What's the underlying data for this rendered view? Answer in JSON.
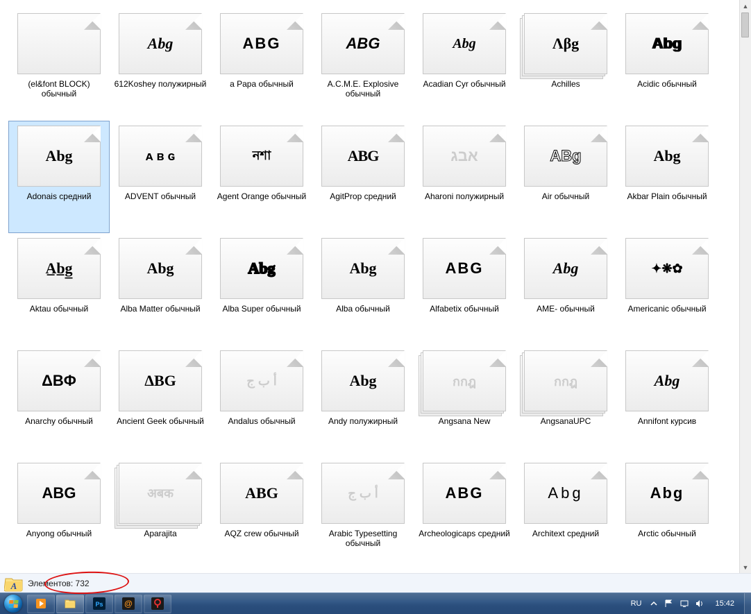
{
  "files": [
    {
      "label": "(el&font BLOCK) обычный",
      "preview": "",
      "stack": false,
      "style": "color:#000"
    },
    {
      "label": "612Koshey полужирный",
      "preview": "Abg",
      "stack": false,
      "style": "font-family:cursive;font-style:italic;font-weight:bold;"
    },
    {
      "label": "a Papa обычный",
      "preview": "ABG",
      "stack": false,
      "style": "font-family:Arial;font-weight:bold;letter-spacing:2px;"
    },
    {
      "label": "A.C.M.E. Explosive обычный",
      "preview": "ABG",
      "stack": false,
      "style": "font-family:Arial;font-weight:bold;font-style:italic;"
    },
    {
      "label": "Acadian Cyr обычный",
      "preview": "Abg",
      "stack": false,
      "style": "font-family:'Times New Roman',serif;font-style:italic;font-size:20px;"
    },
    {
      "label": "Achilles",
      "preview": "Λβg",
      "stack": true,
      "style": "font-family:serif;"
    },
    {
      "label": "Acidic обычный",
      "preview": "Abg",
      "stack": false,
      "style": "font-family:Arial;font-weight:bold;text-shadow:1px 0 #000,-1px 0 #000;"
    },
    {
      "label": "Adonais средний",
      "preview": "Abg",
      "stack": false,
      "style": "font-family:Arial Black;font-weight:900;",
      "selected": true
    },
    {
      "label": "ADVENT обычный",
      "preview": "ᴀ ʙ ɢ",
      "stack": false,
      "style": "font-family:Arial;font-size:18px;font-weight:bold;"
    },
    {
      "label": "Agent Orange обычный",
      "preview": "নশা",
      "stack": false,
      "style": "font-size:18px;"
    },
    {
      "label": "AgitProp средний",
      "preview": "ABG",
      "stack": false,
      "style": "font-family:Arial Black;font-weight:900;letter-spacing:-1px;"
    },
    {
      "label": "Aharoni полужирный",
      "preview": "אבג",
      "stack": false,
      "style": "color:#ccc;font-weight:bold;direction:rtl;"
    },
    {
      "label": "Air обычный",
      "preview": "ABg",
      "stack": false,
      "style": "font-family:Arial;font-weight:bold;-webkit-text-stroke:1px #000;color:#fff;"
    },
    {
      "label": "Akbar Plain обычный",
      "preview": "Abg",
      "stack": false,
      "style": "font-family:'Comic Sans MS',cursive;"
    },
    {
      "label": "Aktau обычный",
      "preview": "A̲b̲g̲",
      "stack": false,
      "style": "font-family:Arial Black;font-weight:900;"
    },
    {
      "label": "Alba Matter обычный",
      "preview": "Abg",
      "stack": false,
      "style": "font-family:Arial Black;font-weight:900;"
    },
    {
      "label": "Alba Super обычный",
      "preview": "Abg",
      "stack": false,
      "style": "font-family:Arial Black;font-weight:900;-webkit-text-stroke:2px #000;color:#000;"
    },
    {
      "label": "Alba обычный",
      "preview": "Abg",
      "stack": false,
      "style": "font-family:Arial Black;font-weight:900;"
    },
    {
      "label": "Alfabetix обычный",
      "preview": "ABG",
      "stack": false,
      "style": "font-family:Arial;letter-spacing:2px;"
    },
    {
      "label": "AME- обычный",
      "preview": "Abg",
      "stack": false,
      "style": "font-family:Arial Black;font-weight:900;font-style:italic;"
    },
    {
      "label": "Americanic обычный",
      "preview": "✦❋✿",
      "stack": false,
      "style": "font-size:18px;"
    },
    {
      "label": "Anarchy обычный",
      "preview": "ΔBΦ",
      "stack": false,
      "style": "font-family:Arial;font-weight:bold;"
    },
    {
      "label": "Ancient Geek обычный",
      "preview": "ΔBG",
      "stack": false,
      "style": "font-family:serif;"
    },
    {
      "label": "Andalus обычный",
      "preview": "أ ب ج",
      "stack": false,
      "style": "color:#ccc;font-size:18px;direction:rtl;"
    },
    {
      "label": "Andy полужирный",
      "preview": "Abg",
      "stack": false,
      "style": "font-family:'Comic Sans MS',cursive;font-weight:bold;"
    },
    {
      "label": "Angsana New",
      "preview": "กกฎ",
      "stack": true,
      "style": "color:#ccc;font-size:18px;"
    },
    {
      "label": "AngsanaUPC",
      "preview": "กกฎ",
      "stack": true,
      "style": "color:#ccc;font-size:18px;"
    },
    {
      "label": "Annifont курсив",
      "preview": "Abg",
      "stack": false,
      "style": "font-family:cursive;font-style:italic;"
    },
    {
      "label": "Anyong обычный",
      "preview": "ABG",
      "stack": false,
      "style": "font-family:Arial;font-weight:bold;"
    },
    {
      "label": "Aparajita",
      "preview": "अबक",
      "stack": true,
      "style": "color:#ccc;font-size:18px;"
    },
    {
      "label": "AQZ crew обычный",
      "preview": "ABG",
      "stack": false,
      "style": "font-family:Arial Black;font-weight:900;"
    },
    {
      "label": "Arabic Typesetting обычный",
      "preview": "أ ب ج",
      "stack": false,
      "style": "color:#ccc;font-size:18px;direction:rtl;"
    },
    {
      "label": "Archeologicaps средний",
      "preview": "ABG",
      "stack": false,
      "style": "font-family:Arial;letter-spacing:2px;"
    },
    {
      "label": "Architext средний",
      "preview": "Abg",
      "stack": false,
      "style": "font-family:Arial;font-weight:100;letter-spacing:4px;"
    },
    {
      "label": "Arctic обычный",
      "preview": "Abg",
      "stack": false,
      "style": "font-family:Arial;letter-spacing:2px;"
    }
  ],
  "details": {
    "label": "Элементов: 732"
  },
  "taskbar": {
    "lang": "RU",
    "clock": "15:42"
  }
}
